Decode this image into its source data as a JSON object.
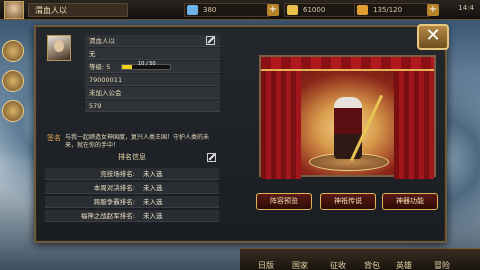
{
  "topbar": {
    "player_name": "渭血人以",
    "resources": [
      {
        "name": "stamina",
        "value": "380",
        "color": "#6fb4e8"
      },
      {
        "name": "gold",
        "value": "61000",
        "color": "#e8c04a"
      },
      {
        "name": "energy",
        "value": "135/120",
        "color": "#e0a030"
      }
    ],
    "status": "14:4"
  },
  "profile": {
    "name": "渭血人以",
    "title": "无",
    "level_label": "等级: 5",
    "exp_text": "10 / 50",
    "exp_fraction": 0.2,
    "id": "79000011",
    "guild": "未加入公会",
    "power": "579"
  },
  "signature": {
    "label": "签名",
    "text": "与我一起缔造女神国度，复兴人类王国！守护人类的未来，就在你的手中！"
  },
  "ranking": {
    "header": "排名信息",
    "rows": [
      {
        "label": "竞技场排名:",
        "value": "未入选"
      },
      {
        "label": "本周对决排名:",
        "value": "未入选"
      },
      {
        "label": "跨服争霸排名:",
        "value": "未入选"
      },
      {
        "label": "福神之战赵军排名:",
        "value": "未入选"
      }
    ]
  },
  "stage_buttons": [
    "阵容预览",
    "神祇传说",
    "神器功能"
  ],
  "bottom_nav": [
    "日版",
    "国家",
    "征收",
    "背包",
    "英雄",
    "冒险"
  ]
}
